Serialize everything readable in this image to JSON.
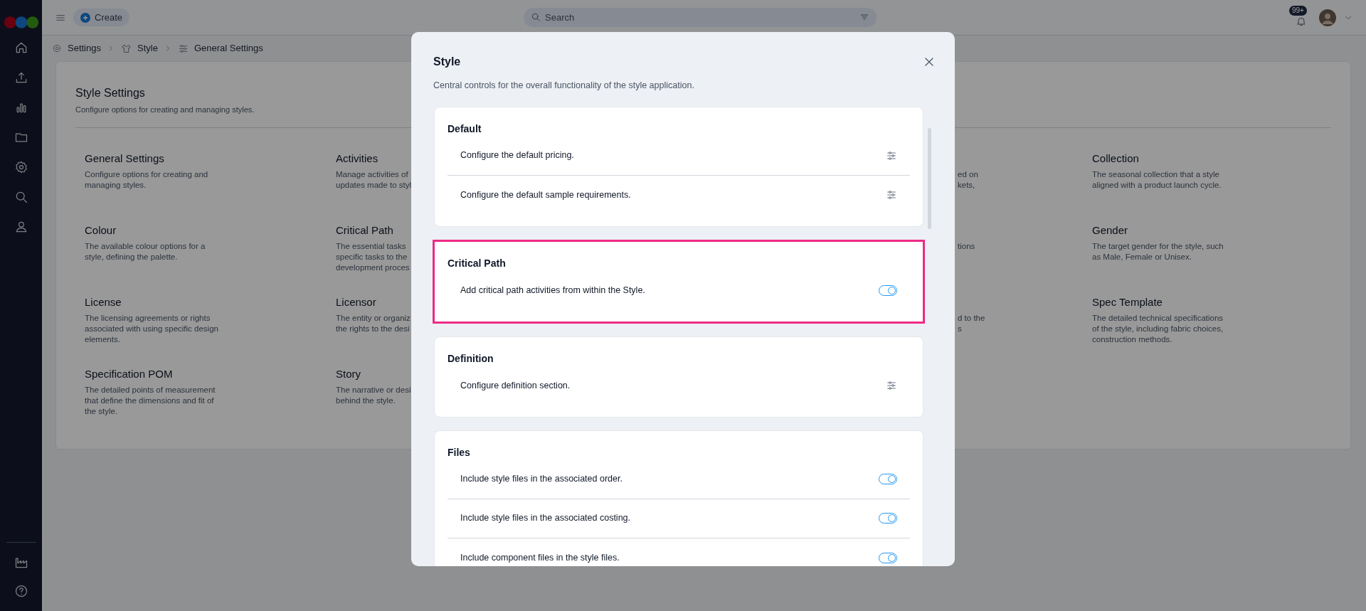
{
  "topbar": {
    "create_label": "Create",
    "search": {
      "placeholder": "Search"
    },
    "notifications_badge": "99+"
  },
  "breadcrumb": [
    "Settings",
    "Style",
    "General Settings"
  ],
  "page": {
    "title": "Style Settings",
    "subtitle": "Configure options for creating and managing styles.",
    "rows": [
      {
        "items": [
          {
            "kind": "card",
            "title": "General Settings",
            "lines": [
              "Configure options for creating and",
              "managing styles."
            ]
          },
          {
            "kind": "card",
            "title": "Activities",
            "lines": [
              "Manage activities of",
              "updates made to styl"
            ]
          },
          {
            "kind": "fragment",
            "lines": [
              "ed on",
              "kets,"
            ]
          },
          {
            "kind": "card",
            "title": "Collection",
            "lines": [
              "The seasonal collection that a style",
              "aligned with a product launch cycle."
            ]
          }
        ]
      },
      {
        "items": [
          {
            "kind": "card",
            "title": "Colour",
            "lines": [
              "The available colour options for a",
              "style, defining the palette."
            ]
          },
          {
            "kind": "card",
            "title": "Critical Path",
            "lines": [
              "The essential tasks",
              "specific tasks to the",
              "development proces"
            ]
          },
          {
            "kind": "fragment",
            "lines": [
              "tions"
            ]
          },
          {
            "kind": "card",
            "title": "Gender",
            "lines": [
              "The target gender for the style, such",
              "as Male, Female or Unisex."
            ]
          }
        ]
      },
      {
        "items": [
          {
            "kind": "card",
            "title": "License",
            "lines": [
              "The licensing agreements or rights",
              "associated with using specific design",
              "elements."
            ]
          },
          {
            "kind": "card",
            "title": "Licensor",
            "lines": [
              "The entity or organiz",
              "the rights to the desi"
            ]
          },
          {
            "kind": "fragment",
            "lines": [
              "d to the",
              "s"
            ]
          },
          {
            "kind": "card",
            "title": "Spec Template",
            "lines": [
              "The detailed technical specifications",
              "of the style, including fabric choices,",
              "construction methods."
            ]
          }
        ]
      },
      {
        "items": [
          {
            "kind": "card",
            "title": "Specification POM",
            "lines": [
              "The detailed points of measurement",
              "that define the dimensions and fit of",
              "the style."
            ]
          },
          {
            "kind": "card",
            "title": "Story",
            "lines": [
              "The narrative or desi",
              "behind the style."
            ]
          }
        ]
      }
    ]
  },
  "modal": {
    "title": "Style",
    "description": "Central controls for the overall functionality of the style application.",
    "sections": [
      {
        "title": "Default",
        "highlighted": false,
        "rows": [
          {
            "kind": "configure",
            "label": "Configure the default pricing."
          },
          {
            "kind": "configure",
            "label": "Configure the default sample requirements."
          }
        ]
      },
      {
        "title": "Critical Path",
        "highlighted": true,
        "rows": [
          {
            "kind": "toggle",
            "label": "Add critical path activities from within the Style.",
            "on": true
          }
        ]
      },
      {
        "title": "Definition",
        "highlighted": false,
        "rows": [
          {
            "kind": "configure",
            "label": "Configure definition section."
          }
        ]
      },
      {
        "title": "Files",
        "highlighted": false,
        "rows": [
          {
            "kind": "toggle",
            "label": "Include style files in the associated order.",
            "on": true
          },
          {
            "kind": "toggle",
            "label": "Include style files in the associated costing.",
            "on": true
          },
          {
            "kind": "toggle",
            "label": "Include component files in the style files.",
            "on": true
          }
        ]
      }
    ]
  }
}
